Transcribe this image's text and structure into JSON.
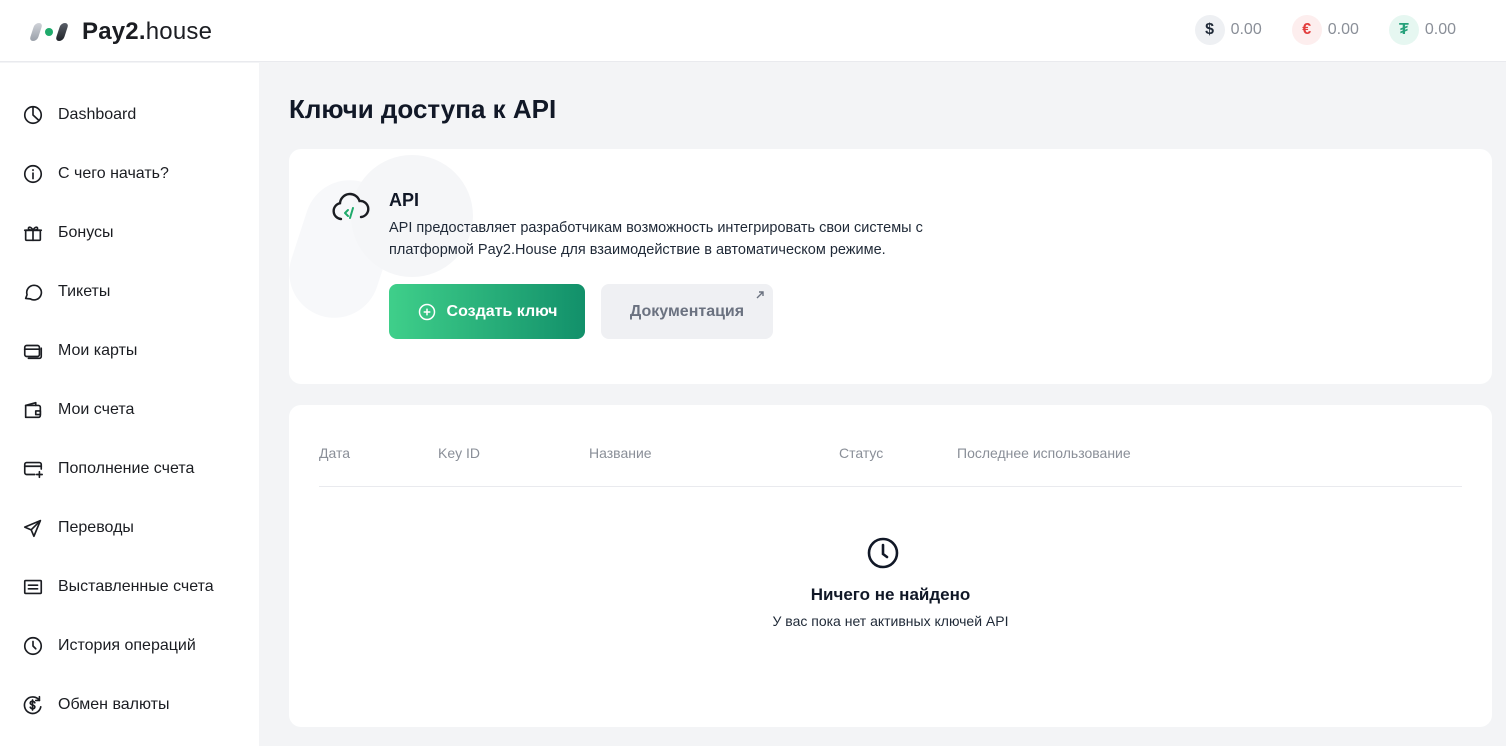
{
  "header": {
    "logo_bold": "Pay2",
    "logo_dot": ".",
    "logo_light": "house",
    "balances": [
      {
        "currency": "usd",
        "symbol": "$",
        "value": "0.00"
      },
      {
        "currency": "eur",
        "symbol": "€",
        "value": "0.00"
      },
      {
        "currency": "usdt",
        "symbol": "₮",
        "value": "0.00"
      }
    ]
  },
  "sidebar": {
    "items": [
      {
        "label": "Dashboard",
        "icon": "pie-chart-icon"
      },
      {
        "label": "С чего начать?",
        "icon": "info-icon"
      },
      {
        "label": "Бонусы",
        "icon": "gift-icon"
      },
      {
        "label": "Тикеты",
        "icon": "chat-icon"
      },
      {
        "label": "Мои карты",
        "icon": "cards-icon"
      },
      {
        "label": "Мои счета",
        "icon": "wallet-icon"
      },
      {
        "label": "Пополнение счета",
        "icon": "card-add-icon"
      },
      {
        "label": "Переводы",
        "icon": "send-icon"
      },
      {
        "label": "Выставленные счета",
        "icon": "invoice-icon"
      },
      {
        "label": "История операций",
        "icon": "clock-icon"
      },
      {
        "label": "Обмен валюты",
        "icon": "exchange-icon"
      }
    ]
  },
  "main": {
    "title": "Ключи доступа к API",
    "api_card": {
      "title": "API",
      "description": "API предоставляет разработчикам возможность интегрировать свои системы с платформой Pay2.House для взаимодействие в автоматическом режиме.",
      "create_button": "Создать ключ",
      "docs_button": "Документация"
    },
    "table": {
      "columns": [
        "Дата",
        "Key ID",
        "Название",
        "Статус",
        "Последнее использование"
      ],
      "empty_title": "Ничего не найдено",
      "empty_subtitle": "У вас пока нет активных ключей API"
    }
  },
  "colors": {
    "accent_start": "#3fcf8a",
    "accent_end": "#12906a",
    "background": "#f3f4f6"
  }
}
